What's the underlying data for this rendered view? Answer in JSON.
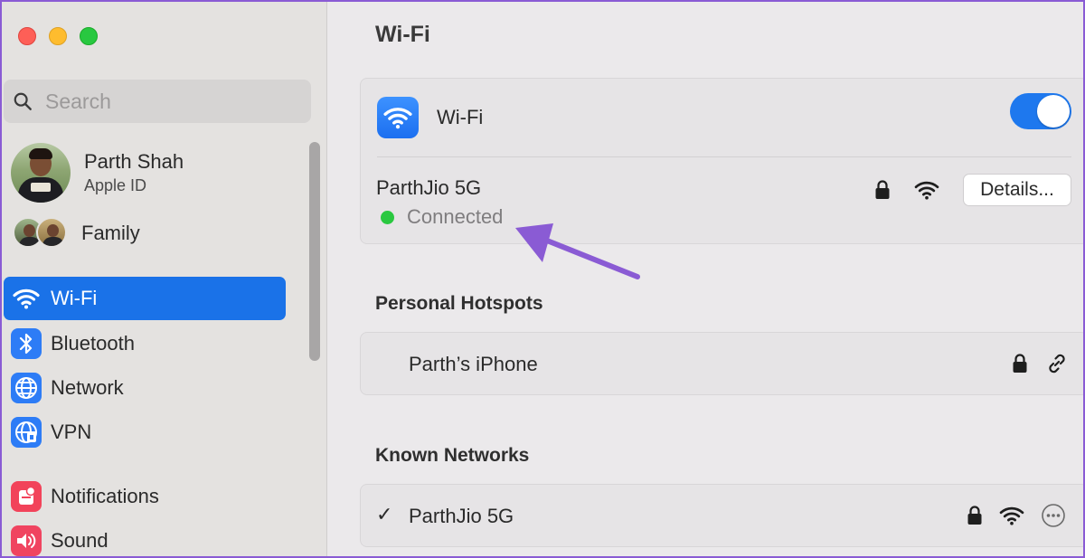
{
  "window": {
    "traffic_lights": [
      "close",
      "minimize",
      "zoom"
    ]
  },
  "sidebar": {
    "search": {
      "placeholder": "Search",
      "icon": "search-icon"
    },
    "profile": {
      "name": "Parth Shah",
      "subtitle": "Apple ID"
    },
    "family": {
      "label": "Family"
    },
    "items": [
      {
        "label": "Wi-Fi",
        "icon": "wifi-icon",
        "selected": true
      },
      {
        "label": "Bluetooth",
        "icon": "bluetooth-icon",
        "selected": false
      },
      {
        "label": "Network",
        "icon": "globe-icon",
        "selected": false
      },
      {
        "label": "VPN",
        "icon": "vpn-globe-icon",
        "selected": false
      },
      {
        "label": "Notifications",
        "icon": "bell-icon",
        "selected": false
      },
      {
        "label": "Sound",
        "icon": "speaker-icon",
        "selected": false
      }
    ]
  },
  "main": {
    "title": "Wi-Fi",
    "wifi_card": {
      "label": "Wi-Fi",
      "toggle_on": true,
      "current_network": {
        "name": "ParthJio 5G",
        "status": "Connected",
        "details_label": "Details..."
      }
    },
    "personal_hotspots": {
      "title": "Personal Hotspots",
      "items": [
        {
          "name": "Parth’s iPhone"
        }
      ]
    },
    "known_networks": {
      "title": "Known Networks",
      "items": [
        {
          "name": "ParthJio 5G",
          "checked": true
        }
      ]
    }
  },
  "colors": {
    "accent": "#1a72e8",
    "status_connected": "#2ac840",
    "annotation_arrow": "#8a5bd4"
  }
}
